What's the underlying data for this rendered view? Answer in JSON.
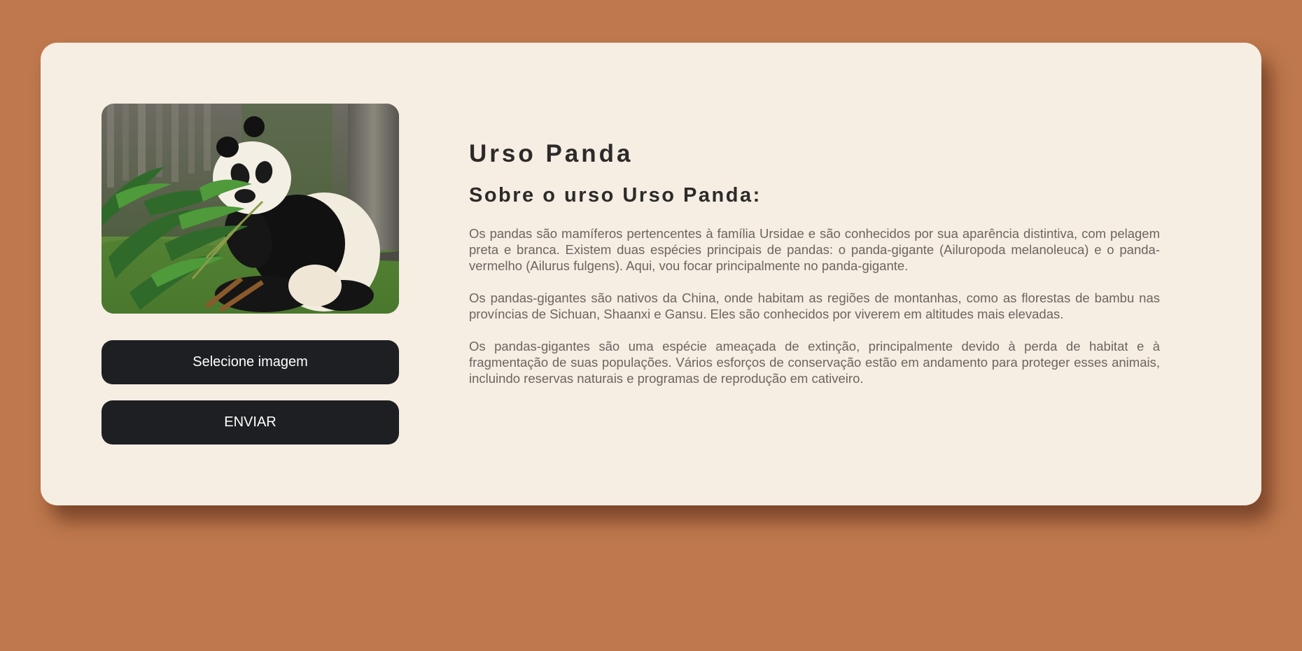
{
  "colors": {
    "background": "#bf784d",
    "card": "#f6ede3",
    "button": "#1e1f23",
    "button_text": "#ffffff",
    "heading": "#2c2b29",
    "body_text": "#6b6660"
  },
  "image": {
    "subject": "giant panda eating bamboo",
    "icon": "panda-photo"
  },
  "buttons": {
    "select_label": "Selecione imagem",
    "send_label": "ENVIAR"
  },
  "content": {
    "title": "Urso Panda",
    "subtitle": "Sobre o urso Urso Panda:",
    "paragraphs": [
      "Os pandas são mamíferos pertencentes à família Ursidae e são conhecidos por sua aparência distintiva, com pelagem preta e branca. Existem duas espécies principais de pandas: o panda-gigante (Ailuropoda melanoleuca) e o panda-vermelho (Ailurus fulgens). Aqui, vou focar principalmente no panda-gigante.",
      "Os pandas-gigantes são nativos da China, onde habitam as regiões de montanhas, como as florestas de bambu nas províncias de Sichuan, Shaanxi e Gansu. Eles são conhecidos por viverem em altitudes mais elevadas.",
      "Os pandas-gigantes são uma espécie ameaçada de extinção, principalmente devido à perda de habitat e à fragmentação de suas populações. Vários esforços de conservação estão em andamento para proteger esses animais, incluindo reservas naturais e programas de reprodução em cativeiro."
    ]
  }
}
